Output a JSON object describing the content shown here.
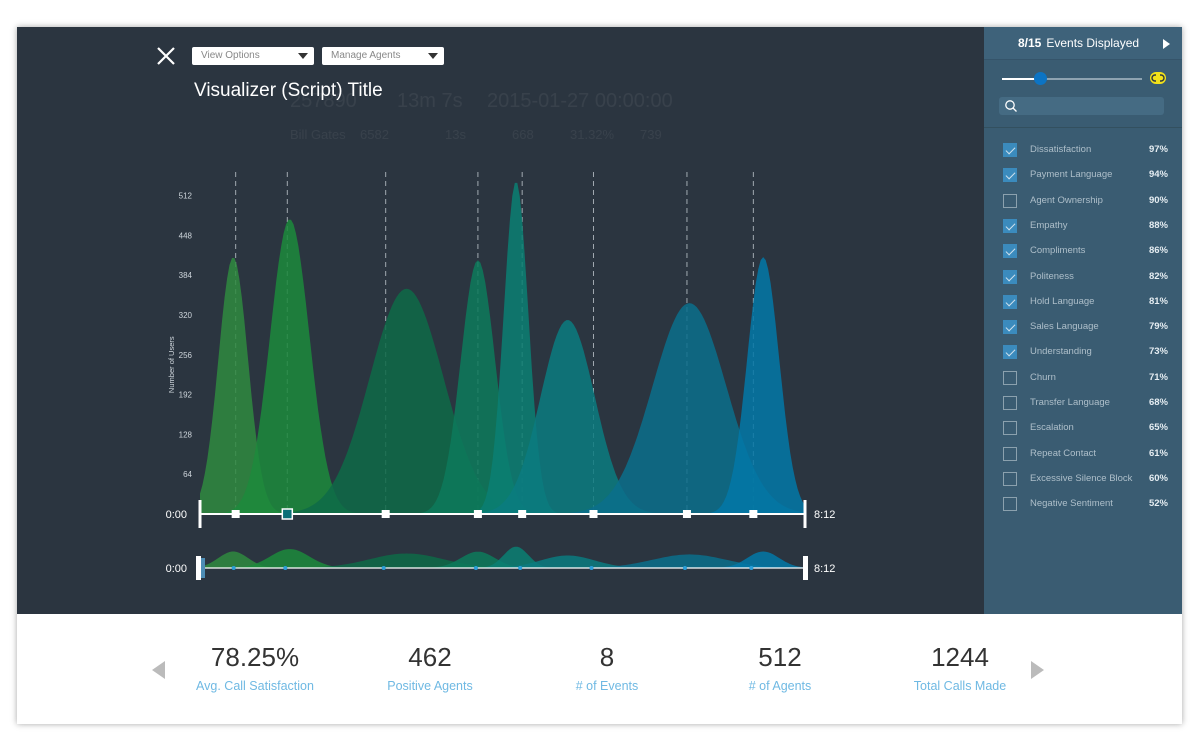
{
  "header": {
    "title": "Visualizer (Script) Title",
    "view_options": "View Options",
    "manage_agents": "Manage Agents",
    "close_icon": "close-icon"
  },
  "background_ghost": [
    "257890",
    "13m 7s",
    "2015-01-27 00:00:00",
    "Bill Gates",
    "6582",
    "13s",
    "668",
    "31.32%",
    "739"
  ],
  "chart_data": {
    "type": "area",
    "ylabel": "Number of Users",
    "yticks": [
      64,
      128,
      192,
      256,
      320,
      384,
      448,
      512
    ],
    "ylim": [
      0,
      540
    ],
    "xlim_seconds": [
      0,
      492
    ],
    "x_start_label": "0:00",
    "x_end_label": "8:12",
    "events_seconds": [
      29,
      71,
      151,
      226,
      262,
      320,
      396,
      450
    ],
    "selected_event_index": 1,
    "series": [
      {
        "center": 27,
        "peak": 413,
        "spread": 12,
        "color": "#2f8a40"
      },
      {
        "center": 73,
        "peak": 474,
        "spread": 16,
        "color": "#1c8a3c"
      },
      {
        "center": 168,
        "peak": 362,
        "spread": 30,
        "color": "#0e6a48"
      },
      {
        "center": 226,
        "peak": 408,
        "spread": 14,
        "color": "#0d7a5c"
      },
      {
        "center": 257,
        "peak": 535,
        "spread": 10,
        "color": "#0b7f73"
      },
      {
        "center": 299,
        "peak": 312,
        "spread": 22,
        "color": "#0b7b80"
      },
      {
        "center": 398,
        "peak": 339,
        "spread": 30,
        "color": "#0a6f8c"
      },
      {
        "center": 458,
        "peak": 413,
        "spread": 13,
        "color": "#0278a8"
      }
    ]
  },
  "sidebar": {
    "count": "8/15",
    "count_label": "Events Displayed",
    "slider_value": 0.27,
    "link_color": "#f2e11a",
    "items": [
      {
        "label": "Dissatisfaction",
        "pct": "97%",
        "checked": true
      },
      {
        "label": "Payment Language",
        "pct": "94%",
        "checked": true
      },
      {
        "label": "Agent Ownership",
        "pct": "90%",
        "checked": false
      },
      {
        "label": "Empathy",
        "pct": "88%",
        "checked": true
      },
      {
        "label": "Compliments",
        "pct": "86%",
        "checked": true
      },
      {
        "label": "Politeness",
        "pct": "82%",
        "checked": true
      },
      {
        "label": "Hold Language",
        "pct": "81%",
        "checked": true
      },
      {
        "label": "Sales Language",
        "pct": "79%",
        "checked": true
      },
      {
        "label": "Understanding",
        "pct": "73%",
        "checked": true
      },
      {
        "label": "Churn",
        "pct": "71%",
        "checked": false
      },
      {
        "label": "Transfer Language",
        "pct": "68%",
        "checked": false
      },
      {
        "label": "Escalation",
        "pct": "65%",
        "checked": false
      },
      {
        "label": "Repeat Contact",
        "pct": "61%",
        "checked": false
      },
      {
        "label": "Excessive Silence Block",
        "pct": "60%",
        "checked": false
      },
      {
        "label": "Negative Sentiment",
        "pct": "52%",
        "checked": false
      }
    ]
  },
  "stats": [
    {
      "value": "78.25%",
      "label": "Avg. Call Satisfaction"
    },
    {
      "value": "462",
      "label": "Positive Agents"
    },
    {
      "value": "8",
      "label": "# of Events"
    },
    {
      "value": "512",
      "label": "# of Agents"
    },
    {
      "value": "1244",
      "label": "Total Calls Made"
    }
  ]
}
